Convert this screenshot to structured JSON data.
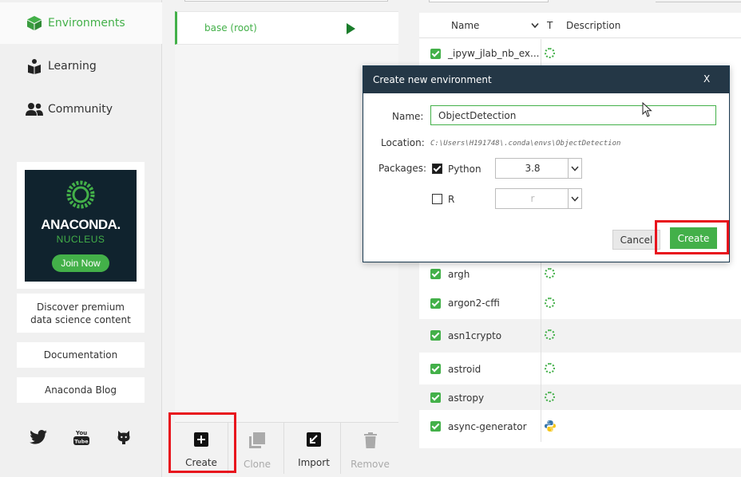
{
  "sidebar": {
    "nav": [
      {
        "label": "Environments",
        "icon": "cube-icon",
        "active": true
      },
      {
        "label": "Learning",
        "icon": "book-reader-icon",
        "active": false
      },
      {
        "label": "Community",
        "icon": "people-icon",
        "active": false
      }
    ],
    "promo": {
      "brand": "ANACONDA.",
      "sub": "NUCLEUS",
      "button": "Join Now"
    },
    "links": [
      "Discover premium data science content",
      "Documentation",
      "Anaconda Blog"
    ],
    "social": [
      "twitter-icon",
      "youtube-icon",
      "github-icon"
    ]
  },
  "environments": {
    "items": [
      {
        "label": "base (root)",
        "active": true
      }
    ],
    "actions": [
      {
        "label": "Create",
        "icon": "plus-square-icon",
        "enabled": true
      },
      {
        "label": "Clone",
        "icon": "clone-icon",
        "enabled": false
      },
      {
        "label": "Import",
        "icon": "import-icon",
        "enabled": true
      },
      {
        "label": "Remove",
        "icon": "trash-icon",
        "enabled": false
      }
    ]
  },
  "packages": {
    "columns": {
      "name": "Name",
      "type": "T",
      "description": "Description"
    },
    "rows": [
      {
        "name": "_ipyw_jlab_nb_ex...",
        "status": "ring"
      },
      {
        "name": "argh",
        "status": "ring"
      },
      {
        "name": "argon2-cffi",
        "status": "ring"
      },
      {
        "name": "asn1crypto",
        "status": "ring"
      },
      {
        "name": "astroid",
        "status": "ring"
      },
      {
        "name": "astropy",
        "status": "ring"
      },
      {
        "name": "async-generator",
        "status": "python"
      }
    ]
  },
  "dialog": {
    "title": "Create new environment",
    "close": "X",
    "name_label": "Name:",
    "name_value": "ObjectDetection",
    "location_label": "Location:",
    "location_value": "C:\\Users\\H191748\\.conda\\envs\\ObjectDetection",
    "packages_label": "Packages:",
    "python": {
      "label": "Python",
      "checked": true,
      "version": "3.8"
    },
    "r": {
      "label": "R",
      "checked": false,
      "version": "r"
    },
    "cancel": "Cancel",
    "create": "Create"
  },
  "colors": {
    "accent": "#43b049",
    "highlight": "#e8141d",
    "dialog_header": "#243746"
  }
}
